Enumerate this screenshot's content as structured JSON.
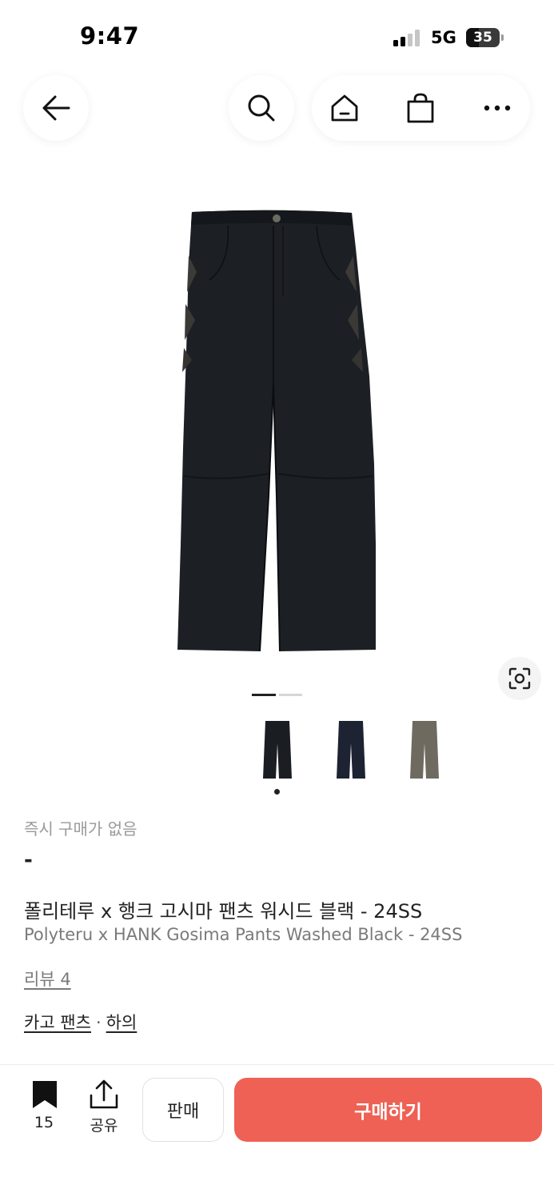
{
  "status": {
    "time": "9:47",
    "network": "5G",
    "battery": "35"
  },
  "nav": {
    "back_icon": "arrow-left-icon",
    "search_icon": "search-icon",
    "home_icon": "home-icon",
    "cart_icon": "shopping-bag-icon",
    "more_icon": "more-dots-icon"
  },
  "gallery": {
    "total_images": 2,
    "current_index": 1,
    "lens_icon": "image-search-icon",
    "variants": [
      {
        "color": "#1a1d22",
        "selected": true
      },
      {
        "color": "#1d2333",
        "selected": false
      },
      {
        "color": "#6f6a5f",
        "selected": false
      }
    ]
  },
  "product": {
    "instant_buy_label": "즉시 구매가 없음",
    "price": "-",
    "name_ko": "폴리테루 x 행크 고시마 팬츠 워시드 블랙 - 24SS",
    "name_en": "Polyteru x HANK Gosima Pants Washed Black - 24SS",
    "review_label": "리뷰 4",
    "category": "카고 팬츠",
    "category_separator": "·",
    "parent_category": "하의"
  },
  "actions": {
    "bookmark_icon": "bookmark-icon",
    "bookmark_count": "15",
    "share_icon": "share-icon",
    "share_label": "공유",
    "sell_label": "판매",
    "buy_label": "구매하기"
  },
  "colors": {
    "accent": "#ee6154",
    "muted_text": "#9a9a9a"
  }
}
